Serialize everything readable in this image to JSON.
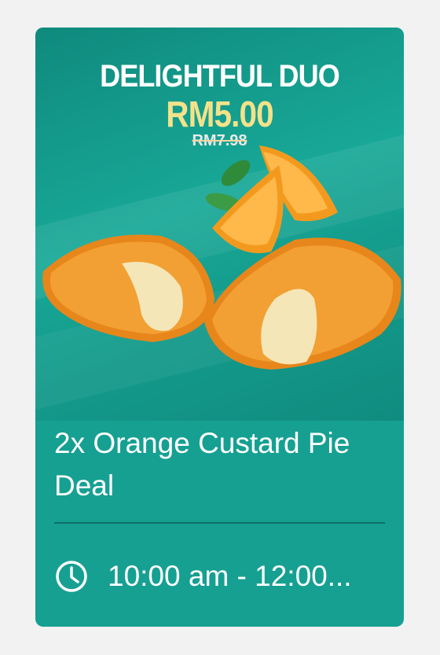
{
  "promo": {
    "headline": "DELIGHTFUL DUO",
    "price": "RM5.00",
    "old_price": "RM7.98"
  },
  "deal": {
    "title": "2x Orange Custard Pie Deal",
    "time": "10:00 am - 12:00...",
    "time_icon": "clock-icon"
  },
  "colors": {
    "card": "#16a092",
    "price": "#f4e28a",
    "divider": "#0e6f66"
  }
}
